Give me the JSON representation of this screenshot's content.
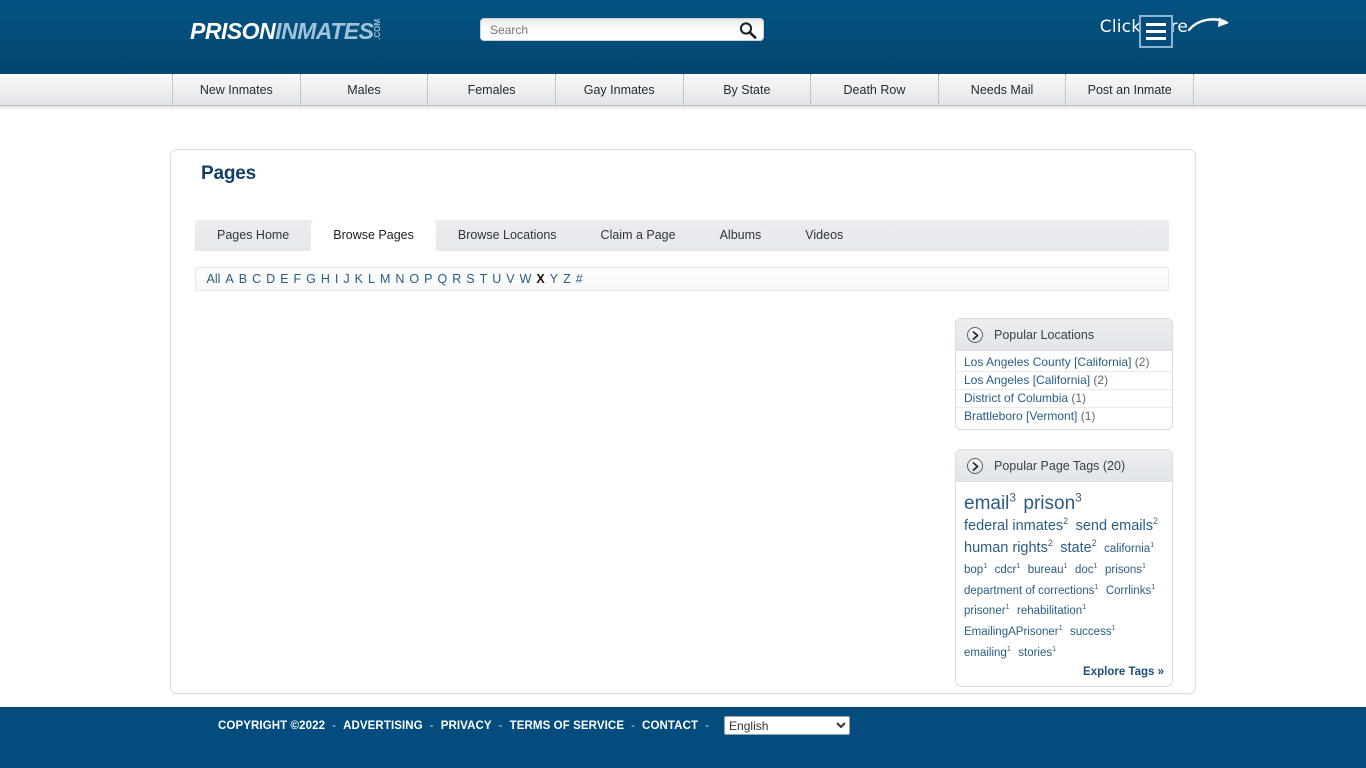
{
  "header": {
    "logo": {
      "part1": "PRISON",
      "part2": "INMATES",
      "tld": ".COM"
    },
    "search": {
      "value": "",
      "placeholder": "Search",
      "icon": "search-icon"
    },
    "click_here_label": "Click Here",
    "menu_icon": "hamburger-menu-icon",
    "bg_color": "#034c7d"
  },
  "nav": {
    "items": [
      {
        "label": "New Inmates"
      },
      {
        "label": "Males"
      },
      {
        "label": "Females"
      },
      {
        "label": "Gay Inmates"
      },
      {
        "label": "By State"
      },
      {
        "label": "Death Row"
      },
      {
        "label": "Needs Mail"
      },
      {
        "label": "Post an Inmate"
      }
    ]
  },
  "main": {
    "title": "Pages",
    "tabs": [
      {
        "label": "Pages Home",
        "active": false
      },
      {
        "label": "Browse Pages",
        "active": true
      },
      {
        "label": "Browse Locations",
        "active": false
      },
      {
        "label": "Claim a Page",
        "active": false
      },
      {
        "label": "Albums",
        "active": false
      },
      {
        "label": "Videos",
        "active": false
      }
    ],
    "alphabet": [
      {
        "label": "All",
        "active": false
      },
      {
        "label": "A",
        "active": false
      },
      {
        "label": "B",
        "active": false
      },
      {
        "label": "C",
        "active": false
      },
      {
        "label": "D",
        "active": false
      },
      {
        "label": "E",
        "active": false
      },
      {
        "label": "F",
        "active": false
      },
      {
        "label": "G",
        "active": false
      },
      {
        "label": "H",
        "active": false
      },
      {
        "label": "I",
        "active": false
      },
      {
        "label": "J",
        "active": false
      },
      {
        "label": "K",
        "active": false
      },
      {
        "label": "L",
        "active": false
      },
      {
        "label": "M",
        "active": false
      },
      {
        "label": "N",
        "active": false
      },
      {
        "label": "O",
        "active": false
      },
      {
        "label": "P",
        "active": false
      },
      {
        "label": "Q",
        "active": false
      },
      {
        "label": "R",
        "active": false
      },
      {
        "label": "S",
        "active": false
      },
      {
        "label": "T",
        "active": false
      },
      {
        "label": "U",
        "active": false
      },
      {
        "label": "V",
        "active": false
      },
      {
        "label": "W",
        "active": false
      },
      {
        "label": "X",
        "active": true
      },
      {
        "label": "Y",
        "active": false
      },
      {
        "label": "Z",
        "active": false
      },
      {
        "label": "#",
        "active": false
      }
    ],
    "results": {
      "items": []
    }
  },
  "sidebar": {
    "locations_panel": {
      "title": "Popular Locations",
      "chevron_icon": "chevron-right-icon",
      "items": [
        {
          "name": "Los Angeles County [California]",
          "count": "(2)"
        },
        {
          "name": "Los Angeles [California]",
          "count": "(2)"
        },
        {
          "name": "District of Columbia",
          "count": "(1)"
        },
        {
          "name": "Brattleboro [Vermont]",
          "count": "(1)"
        }
      ]
    },
    "tags_panel": {
      "title": "Popular Page Tags (20)",
      "chevron_icon": "chevron-right-icon",
      "explore_label": "Explore Tags »",
      "tags": [
        {
          "label": "email",
          "count": "3",
          "size": 3
        },
        {
          "label": "prison",
          "count": "3",
          "size": 3
        },
        {
          "label": "federal inmates",
          "count": "2",
          "size": 2
        },
        {
          "label": "send emails",
          "count": "2",
          "size": 2
        },
        {
          "label": "human rights",
          "count": "2",
          "size": 2
        },
        {
          "label": "state",
          "count": "2",
          "size": 2
        },
        {
          "label": "california",
          "count": "1",
          "size": 1
        },
        {
          "label": "bop",
          "count": "1",
          "size": 1
        },
        {
          "label": "cdcr",
          "count": "1",
          "size": 1
        },
        {
          "label": "bureau",
          "count": "1",
          "size": 1
        },
        {
          "label": "doc",
          "count": "1",
          "size": 1
        },
        {
          "label": "prisons",
          "count": "1",
          "size": 1
        },
        {
          "label": "department of corrections",
          "count": "1",
          "size": 1
        },
        {
          "label": "Corrlinks",
          "count": "1",
          "size": 1
        },
        {
          "label": "prisoner",
          "count": "1",
          "size": 1
        },
        {
          "label": "rehabilitation",
          "count": "1",
          "size": 1
        },
        {
          "label": "EmailingAPrisoner",
          "count": "1",
          "size": 1
        },
        {
          "label": "success",
          "count": "1",
          "size": 1
        },
        {
          "label": "emailing",
          "count": "1",
          "size": 1
        },
        {
          "label": "stories",
          "count": "1",
          "size": 1
        }
      ]
    }
  },
  "footer": {
    "copyright": "COPYRIGHT ©2022",
    "links": [
      {
        "label": "ADVERTISING"
      },
      {
        "label": "PRIVACY"
      },
      {
        "label": "TERMS OF SERVICE"
      },
      {
        "label": "CONTACT"
      }
    ],
    "separator": "-",
    "language": {
      "selected": "English",
      "options": [
        "English"
      ]
    },
    "bg_color": "#034c7d"
  }
}
